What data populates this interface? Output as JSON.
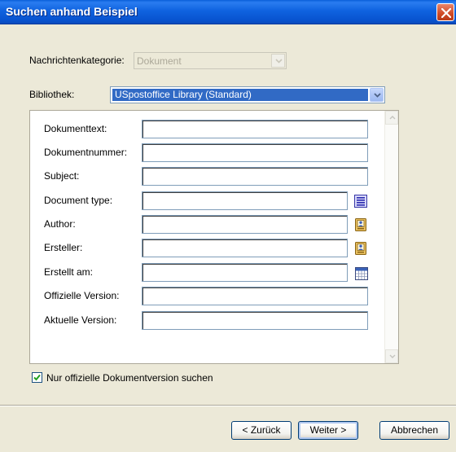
{
  "window": {
    "title": "Suchen anhand Beispiel"
  },
  "category": {
    "label": "Nachrichtenkategorie:",
    "value": "Dokument"
  },
  "library": {
    "label": "Bibliothek:",
    "value": "USpostoffice Library (Standard)"
  },
  "fields": [
    {
      "label": "Dokumenttext:",
      "value": ""
    },
    {
      "label": "Dokumentnummer:",
      "value": ""
    },
    {
      "label": "Subject:",
      "value": ""
    },
    {
      "label": "Document type:",
      "value": ""
    },
    {
      "label": "Author:",
      "value": ""
    },
    {
      "label": "Ersteller:",
      "value": ""
    },
    {
      "label": "Erstellt am:",
      "value": ""
    },
    {
      "label": "Offizielle Version:",
      "value": ""
    },
    {
      "label": "Aktuelle Version:",
      "value": ""
    }
  ],
  "checkbox": {
    "label": "Nur offizielle Dokumentversion suchen",
    "checked": true
  },
  "buttons": {
    "back": "< Zurück",
    "next": "Weiter >",
    "cancel": "Abbrechen"
  },
  "icons": {
    "close": "close-icon",
    "document_type": "list-icon",
    "author": "address-book-icon",
    "creator": "address-book-icon",
    "created_on": "calendar-icon"
  },
  "colors": {
    "titlebar": "#0a5fd9",
    "selection": "#316ac5",
    "dialog_bg": "#ece9d8"
  }
}
